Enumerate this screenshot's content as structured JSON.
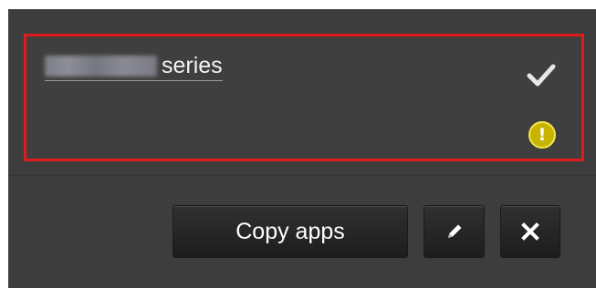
{
  "printer": {
    "model_redacted": true,
    "series_label": "series",
    "status_icon": "check-icon",
    "alert_icon": "warning-icon",
    "alert_glyph": "!"
  },
  "actions": {
    "copy_label": "Copy apps",
    "edit_icon": "pencil-icon",
    "delete_icon": "close-icon"
  },
  "colors": {
    "panel_bg": "#3d3d3d",
    "selection_border": "#e01b1b",
    "warning": "#c8b400",
    "button_bg": "#1d1d1d"
  }
}
